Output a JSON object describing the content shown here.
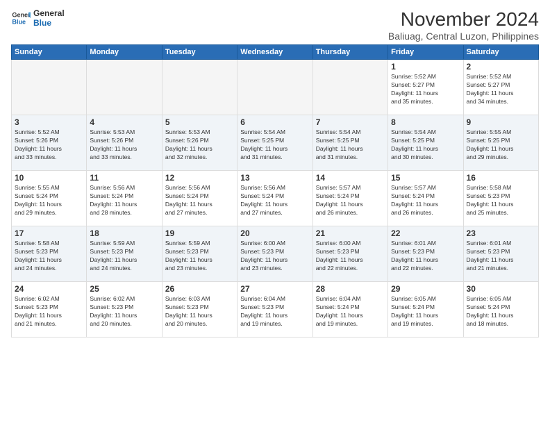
{
  "logo": {
    "line1": "General",
    "line2": "Blue"
  },
  "title": "November 2024",
  "location": "Baliuag, Central Luzon, Philippines",
  "headers": [
    "Sunday",
    "Monday",
    "Tuesday",
    "Wednesday",
    "Thursday",
    "Friday",
    "Saturday"
  ],
  "weeks": [
    [
      {
        "day": "",
        "info": "",
        "empty": true
      },
      {
        "day": "",
        "info": "",
        "empty": true
      },
      {
        "day": "",
        "info": "",
        "empty": true
      },
      {
        "day": "",
        "info": "",
        "empty": true
      },
      {
        "day": "",
        "info": "",
        "empty": true
      },
      {
        "day": "1",
        "info": "Sunrise: 5:52 AM\nSunset: 5:27 PM\nDaylight: 11 hours\nand 35 minutes.",
        "empty": false
      },
      {
        "day": "2",
        "info": "Sunrise: 5:52 AM\nSunset: 5:27 PM\nDaylight: 11 hours\nand 34 minutes.",
        "empty": false
      }
    ],
    [
      {
        "day": "3",
        "info": "Sunrise: 5:52 AM\nSunset: 5:26 PM\nDaylight: 11 hours\nand 33 minutes.",
        "empty": false
      },
      {
        "day": "4",
        "info": "Sunrise: 5:53 AM\nSunset: 5:26 PM\nDaylight: 11 hours\nand 33 minutes.",
        "empty": false
      },
      {
        "day": "5",
        "info": "Sunrise: 5:53 AM\nSunset: 5:26 PM\nDaylight: 11 hours\nand 32 minutes.",
        "empty": false
      },
      {
        "day": "6",
        "info": "Sunrise: 5:54 AM\nSunset: 5:25 PM\nDaylight: 11 hours\nand 31 minutes.",
        "empty": false
      },
      {
        "day": "7",
        "info": "Sunrise: 5:54 AM\nSunset: 5:25 PM\nDaylight: 11 hours\nand 31 minutes.",
        "empty": false
      },
      {
        "day": "8",
        "info": "Sunrise: 5:54 AM\nSunset: 5:25 PM\nDaylight: 11 hours\nand 30 minutes.",
        "empty": false
      },
      {
        "day": "9",
        "info": "Sunrise: 5:55 AM\nSunset: 5:25 PM\nDaylight: 11 hours\nand 29 minutes.",
        "empty": false
      }
    ],
    [
      {
        "day": "10",
        "info": "Sunrise: 5:55 AM\nSunset: 5:24 PM\nDaylight: 11 hours\nand 29 minutes.",
        "empty": false
      },
      {
        "day": "11",
        "info": "Sunrise: 5:56 AM\nSunset: 5:24 PM\nDaylight: 11 hours\nand 28 minutes.",
        "empty": false
      },
      {
        "day": "12",
        "info": "Sunrise: 5:56 AM\nSunset: 5:24 PM\nDaylight: 11 hours\nand 27 minutes.",
        "empty": false
      },
      {
        "day": "13",
        "info": "Sunrise: 5:56 AM\nSunset: 5:24 PM\nDaylight: 11 hours\nand 27 minutes.",
        "empty": false
      },
      {
        "day": "14",
        "info": "Sunrise: 5:57 AM\nSunset: 5:24 PM\nDaylight: 11 hours\nand 26 minutes.",
        "empty": false
      },
      {
        "day": "15",
        "info": "Sunrise: 5:57 AM\nSunset: 5:24 PM\nDaylight: 11 hours\nand 26 minutes.",
        "empty": false
      },
      {
        "day": "16",
        "info": "Sunrise: 5:58 AM\nSunset: 5:23 PM\nDaylight: 11 hours\nand 25 minutes.",
        "empty": false
      }
    ],
    [
      {
        "day": "17",
        "info": "Sunrise: 5:58 AM\nSunset: 5:23 PM\nDaylight: 11 hours\nand 24 minutes.",
        "empty": false
      },
      {
        "day": "18",
        "info": "Sunrise: 5:59 AM\nSunset: 5:23 PM\nDaylight: 11 hours\nand 24 minutes.",
        "empty": false
      },
      {
        "day": "19",
        "info": "Sunrise: 5:59 AM\nSunset: 5:23 PM\nDaylight: 11 hours\nand 23 minutes.",
        "empty": false
      },
      {
        "day": "20",
        "info": "Sunrise: 6:00 AM\nSunset: 5:23 PM\nDaylight: 11 hours\nand 23 minutes.",
        "empty": false
      },
      {
        "day": "21",
        "info": "Sunrise: 6:00 AM\nSunset: 5:23 PM\nDaylight: 11 hours\nand 22 minutes.",
        "empty": false
      },
      {
        "day": "22",
        "info": "Sunrise: 6:01 AM\nSunset: 5:23 PM\nDaylight: 11 hours\nand 22 minutes.",
        "empty": false
      },
      {
        "day": "23",
        "info": "Sunrise: 6:01 AM\nSunset: 5:23 PM\nDaylight: 11 hours\nand 21 minutes.",
        "empty": false
      }
    ],
    [
      {
        "day": "24",
        "info": "Sunrise: 6:02 AM\nSunset: 5:23 PM\nDaylight: 11 hours\nand 21 minutes.",
        "empty": false
      },
      {
        "day": "25",
        "info": "Sunrise: 6:02 AM\nSunset: 5:23 PM\nDaylight: 11 hours\nand 20 minutes.",
        "empty": false
      },
      {
        "day": "26",
        "info": "Sunrise: 6:03 AM\nSunset: 5:23 PM\nDaylight: 11 hours\nand 20 minutes.",
        "empty": false
      },
      {
        "day": "27",
        "info": "Sunrise: 6:04 AM\nSunset: 5:23 PM\nDaylight: 11 hours\nand 19 minutes.",
        "empty": false
      },
      {
        "day": "28",
        "info": "Sunrise: 6:04 AM\nSunset: 5:24 PM\nDaylight: 11 hours\nand 19 minutes.",
        "empty": false
      },
      {
        "day": "29",
        "info": "Sunrise: 6:05 AM\nSunset: 5:24 PM\nDaylight: 11 hours\nand 19 minutes.",
        "empty": false
      },
      {
        "day": "30",
        "info": "Sunrise: 6:05 AM\nSunset: 5:24 PM\nDaylight: 11 hours\nand 18 minutes.",
        "empty": false
      }
    ]
  ]
}
